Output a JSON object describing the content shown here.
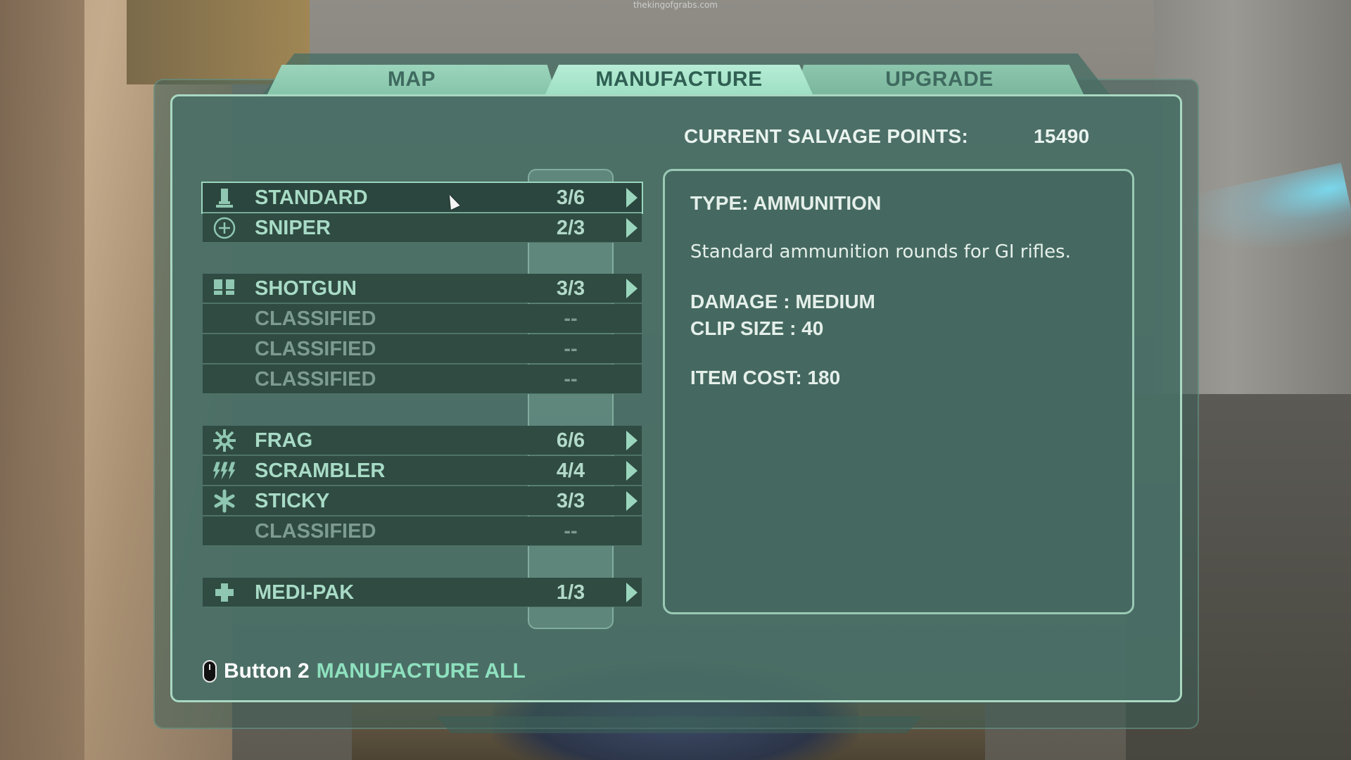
{
  "watermark": "thekingofgrabs.com",
  "tabs": [
    {
      "label": "MAP"
    },
    {
      "label": "MANUFACTURE",
      "active": true
    },
    {
      "label": "UPGRADE"
    }
  ],
  "salvage": {
    "label": "CURRENT SALVAGE POINTS:",
    "value": "15490"
  },
  "items": [
    {
      "icon": "bullet-icon",
      "label": "STANDARD",
      "count": "3/6",
      "available": true,
      "selected": true
    },
    {
      "icon": "crosshair-icon",
      "label": "SNIPER",
      "count": "2/3",
      "available": true
    },
    {
      "icon": "shotgun-shells-icon",
      "label": "SHOTGUN",
      "count": "3/3",
      "available": true
    },
    {
      "icon": "",
      "label": "CLASSIFIED",
      "count": "--",
      "available": false
    },
    {
      "icon": "",
      "label": "CLASSIFIED",
      "count": "--",
      "available": false
    },
    {
      "icon": "",
      "label": "CLASSIFIED",
      "count": "--",
      "available": false
    },
    {
      "icon": "frag-grenade-icon",
      "label": "FRAG",
      "count": "6/6",
      "available": true
    },
    {
      "icon": "lightning-icon",
      "label": "SCRAMBLER",
      "count": "4/4",
      "available": true
    },
    {
      "icon": "sticky-grenade-icon",
      "label": "STICKY",
      "count": "3/3",
      "available": true
    },
    {
      "icon": "",
      "label": "CLASSIFIED",
      "count": "--",
      "available": false
    },
    {
      "icon": "medical-cross-icon",
      "label": "MEDI-PAK",
      "count": "1/3",
      "available": true
    }
  ],
  "details": {
    "type": "TYPE: AMMUNITION",
    "description": "Standard ammunition rounds for GI rifles.",
    "damage": "DAMAGE : MEDIUM",
    "clip": "CLIP SIZE : 40",
    "cost": "ITEM COST: 180"
  },
  "footer": {
    "button": "Button 2",
    "action": "MANUFACTURE ALL"
  },
  "colors": {
    "accent": "#8ee0be",
    "panel": "#4a7066",
    "row": "#2f4b42",
    "border": "#a9d8c2"
  }
}
